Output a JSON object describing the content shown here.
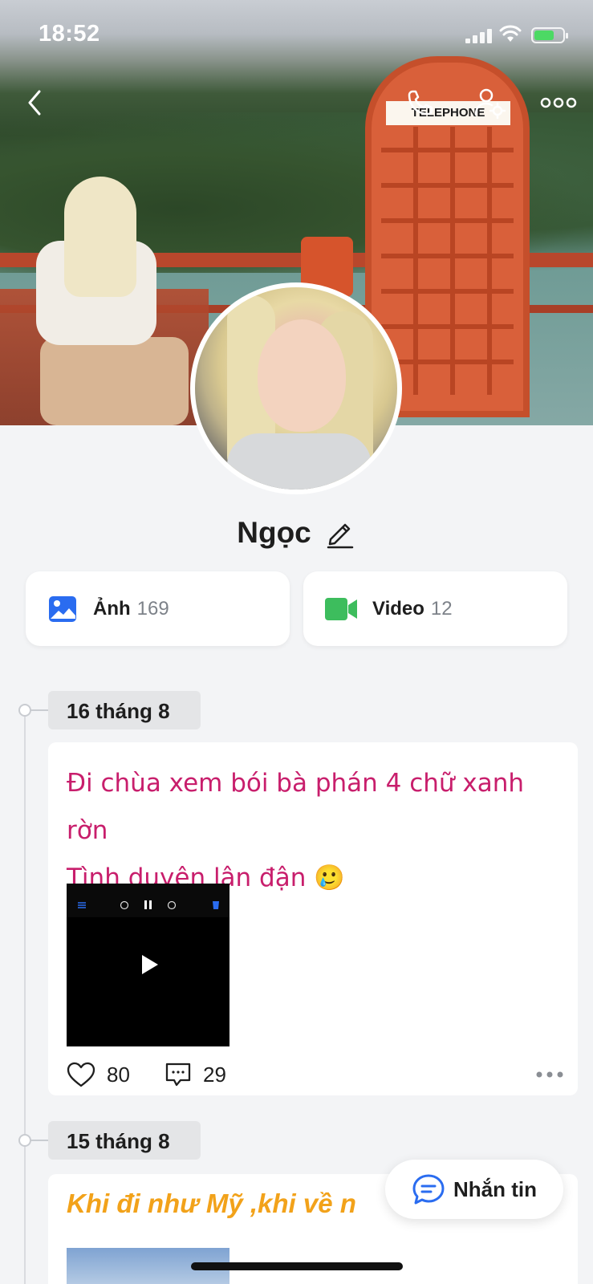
{
  "status_bar": {
    "time": "18:52"
  },
  "cover": {
    "booth_sign": "TELEPHONE"
  },
  "profile": {
    "name": "Ngọc"
  },
  "media": [
    {
      "label": "Ảnh",
      "count": "169",
      "icon": "image-icon",
      "color": "#2a6cf0"
    },
    {
      "label": "Video",
      "count": "12",
      "icon": "video-camera-icon",
      "color": "#3dbd5d"
    }
  ],
  "timeline": [
    {
      "date": "16 tháng 8",
      "text_line1": "Đi chùa xem bói bà phán 4 chữ xanh rờn",
      "text_line2": "Tình duyên lận đận 🥲",
      "text_color": "#c81e6c",
      "likes": "80",
      "comments": "29"
    },
    {
      "date": "15 tháng 8",
      "text": "Khi đi như Mỹ ,khi về n",
      "text_color": "#f2a21a"
    }
  ],
  "message_button": {
    "label": "Nhắn tin"
  }
}
